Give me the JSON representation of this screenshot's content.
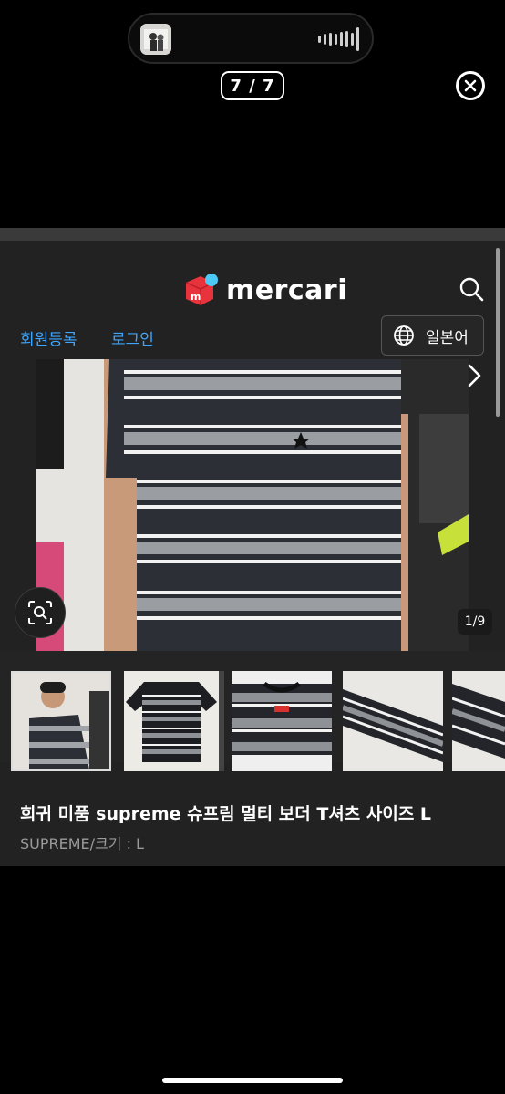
{
  "story": {
    "counter": "7 / 7"
  },
  "site": {
    "logo_text": "mercari"
  },
  "nav": {
    "signup_label": "회원등록",
    "login_label": "로그인",
    "language_label": "일본어"
  },
  "gallery": {
    "pager": "1/9"
  },
  "product": {
    "title": "희귀 미품 supreme 슈프림 멀티 보더 T셔츠 사이즈 L",
    "subtitle": "SUPREME/크기 : L"
  },
  "colors": {
    "link": "#3ea6ff",
    "brand_red": "#e8333c",
    "brand_blue": "#4dc9f6"
  }
}
